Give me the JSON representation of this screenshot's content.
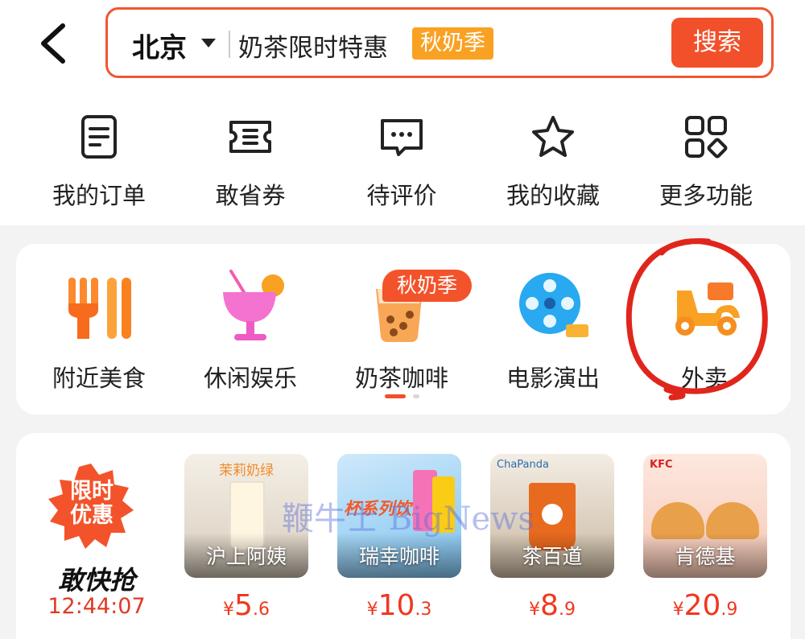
{
  "header": {
    "city": "北京",
    "search_text": "奶茶限时特惠",
    "search_tag": "秋奶季",
    "search_button": "搜索"
  },
  "quick_actions": [
    {
      "label": "我的订单",
      "icon": "order-icon"
    },
    {
      "label": "敢省券",
      "icon": "coupon-icon"
    },
    {
      "label": "待评价",
      "icon": "comment-icon"
    },
    {
      "label": "我的收藏",
      "icon": "star-icon"
    },
    {
      "label": "更多功能",
      "icon": "grid-icon"
    }
  ],
  "categories": {
    "badge": "秋奶季",
    "items": [
      {
        "label": "附近美食",
        "icon": "fork-icon"
      },
      {
        "label": "休闲娱乐",
        "icon": "cocktail-icon"
      },
      {
        "label": "奶茶咖啡",
        "icon": "milk-tea-icon"
      },
      {
        "label": "电影演出",
        "icon": "film-reel-icon"
      },
      {
        "label": "外卖",
        "icon": "scooter-icon"
      }
    ]
  },
  "flash_sale": {
    "badge_line1": "限时",
    "badge_line2": "优惠",
    "title": "敢快抢",
    "countdown": "12:44:07"
  },
  "deals": [
    {
      "name": "沪上阿姨",
      "currency": "¥",
      "price_int": "5",
      "price_dec": ".6",
      "thumb_caption": "茉莉奶绿"
    },
    {
      "name": "瑞幸咖啡",
      "currency": "¥",
      "price_int": "10",
      "price_dec": ".3",
      "thumb_caption": "杯系列饮品"
    },
    {
      "name": "茶百道",
      "currency": "¥",
      "price_int": "8",
      "price_dec": ".9",
      "thumb_caption": "ChaPanda"
    },
    {
      "name": "肯德基",
      "currency": "¥",
      "price_int": "20",
      "price_dec": ".9",
      "thumb_caption": "KFC"
    }
  ],
  "watermark": "鞭牛士 BigNews",
  "colors": {
    "accent": "#f2502a",
    "orange": "#f9a123",
    "price": "#f0381f"
  }
}
